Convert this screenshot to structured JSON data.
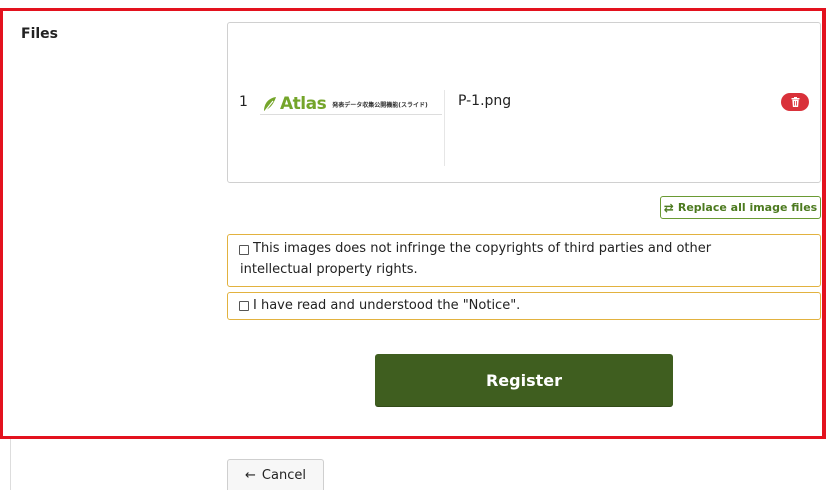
{
  "files_section": {
    "label": "Files",
    "items": [
      {
        "index": "1",
        "thumbnail": {
          "logo_text": "Atlas",
          "caption": "発表データ収集公開機能(スライド)"
        },
        "file_name": "P-1.png",
        "delete_icon": "trash-icon"
      }
    ],
    "replace_label": "Replace all image files",
    "replace_icon": "swap-arrows-icon"
  },
  "agreements": {
    "copyright_text_line1": "This images does not infringe the copyrights of third parties and other",
    "copyright_text_line2": "intellectual property rights.",
    "notice_text": "I have read and understood the \"Notice\"."
  },
  "actions": {
    "register_label": "Register",
    "cancel_label": "Cancel",
    "cancel_icon": "arrow-left-icon"
  },
  "colors": {
    "highlight_frame": "#e3121e",
    "register_bg": "#3f5e1f",
    "replace_accent": "#4c7a1f",
    "agreement_border": "#e2b23f",
    "delete_bg": "#d9313a",
    "logo_green": "#74a52a"
  }
}
